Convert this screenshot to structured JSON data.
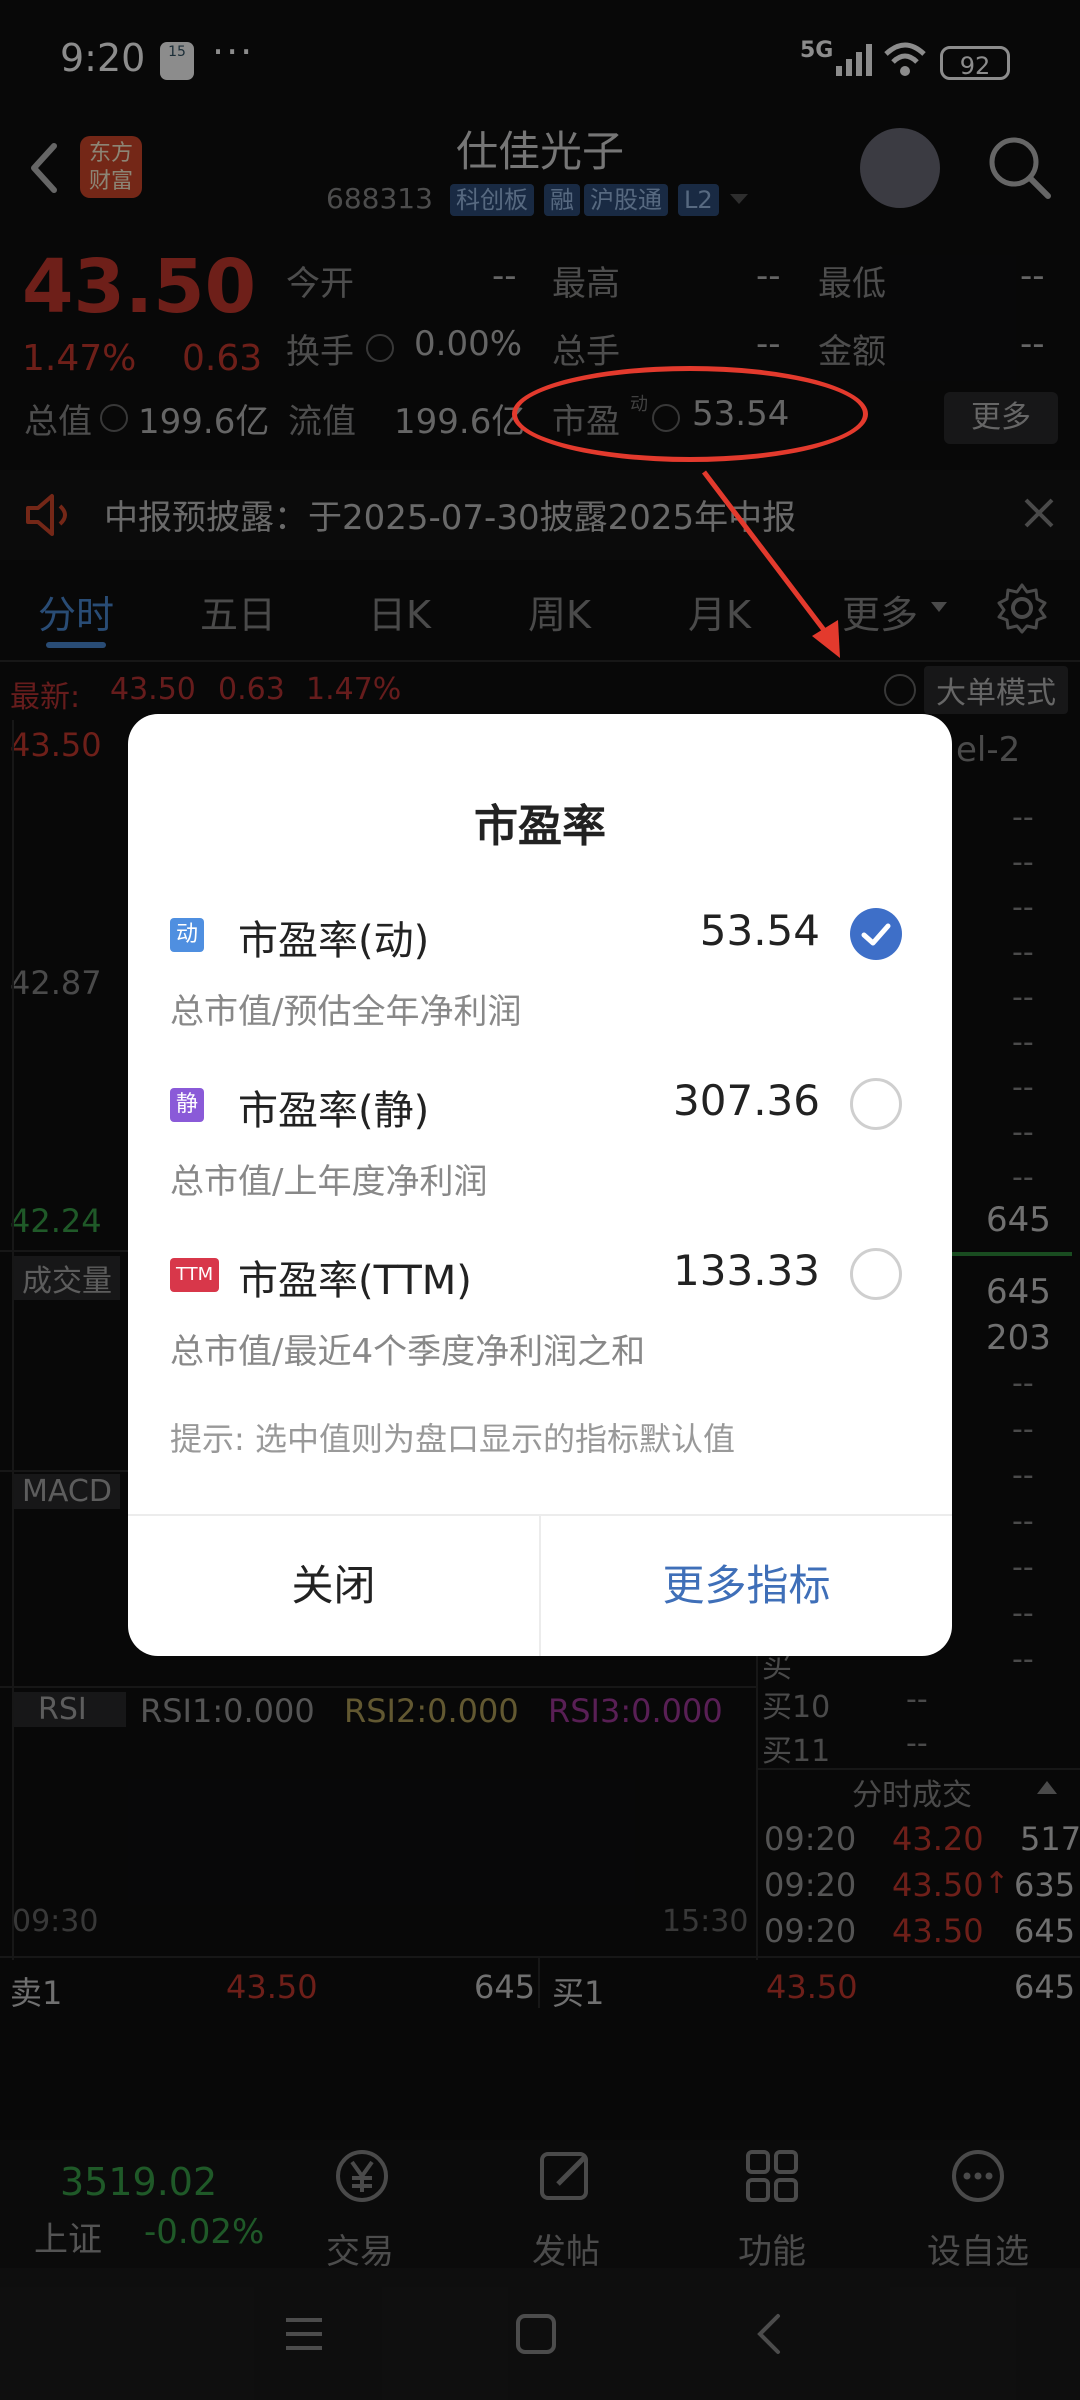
{
  "status_bar": {
    "time": "9:20",
    "calendar_day": "15",
    "more": "···",
    "network": "5G",
    "battery": "92"
  },
  "header": {
    "logo_text": "东方财富",
    "stock_name": "仕佳光子",
    "stock_code": "688313",
    "tags": [
      "科创板",
      "融",
      "沪股通",
      "L2"
    ]
  },
  "quote": {
    "price": "43.50",
    "change_pct": "1.47%",
    "change_abs": "0.63",
    "rows": [
      [
        {
          "label": "今开",
          "value": "--"
        },
        {
          "label": "最高",
          "value": "--"
        },
        {
          "label": "最低",
          "value": "--"
        }
      ],
      [
        {
          "label": "换手",
          "value": "0.00%"
        },
        {
          "label": "总手",
          "value": "--"
        },
        {
          "label": "金额",
          "value": "--"
        }
      ]
    ],
    "total_value_label": "总值",
    "total_value": "199.6亿",
    "float_value_label": "流值",
    "float_value": "199.6亿",
    "pe_label": "市盈",
    "pe_sup": "动",
    "pe_value": "53.54",
    "more_button": "更多"
  },
  "notice": {
    "text": "中报预披露：于2025-07-30披露2025年中报"
  },
  "tabs": [
    "分时",
    "五日",
    "日K",
    "周K",
    "月K",
    "更多"
  ],
  "chart": {
    "latest_label": "最新:",
    "latest_price": "43.50",
    "latest_change": "0.63",
    "latest_pct": "1.47%",
    "mode_button": "大单模式",
    "level_label": "el-2",
    "y_high": "43.50",
    "y_mid": "42.87",
    "y_low": "42.24",
    "volume_label": "成交量",
    "macd_label": "MACD",
    "rsi_label": "RSI",
    "rsi1": "RSI1:0.000",
    "rsi2": "RSI2:0.000",
    "rsi3": "RSI3:0.000",
    "time_start": "09:30",
    "time_end": "15:30"
  },
  "order_book": {
    "right_values": [
      "--",
      "--",
      "--",
      "--",
      "--",
      "--",
      "--",
      "--",
      "--",
      "645",
      "645",
      "203",
      "--",
      "--",
      "--",
      "--",
      "--",
      "--",
      "--"
    ],
    "buy10_label": "买10",
    "buy10_value": "--",
    "buy11_label": "买11",
    "buy11_value": "--",
    "buy_partial": "买"
  },
  "ticks": {
    "title": "分时成交",
    "rows": [
      {
        "time": "09:20",
        "price": "43.20",
        "vol": "517",
        "arrow": ""
      },
      {
        "time": "09:20",
        "price": "43.50",
        "vol": "635",
        "arrow": "↑"
      },
      {
        "time": "09:20",
        "price": "43.50",
        "vol": "645",
        "arrow": ""
      }
    ]
  },
  "bottom_quote": [
    {
      "label": "卖1",
      "price": "43.50",
      "vol": "645"
    },
    {
      "label": "买1",
      "price": "43.50",
      "vol": "645"
    }
  ],
  "bottom_nav": {
    "index_value": "3519.02",
    "index_name": "上证",
    "index_change": "-0.02%",
    "items": [
      "交易",
      "发帖",
      "功能",
      "设自选"
    ]
  },
  "dialog": {
    "title": "市盈率",
    "options": [
      {
        "badge": "动",
        "badge_color": "#4f8fe0",
        "name": "市盈率(动)",
        "value": "53.54",
        "desc": "总市值/预估全年净利润",
        "selected": true
      },
      {
        "badge": "静",
        "badge_color": "#8a5ad8",
        "name": "市盈率(静)",
        "value": "307.36",
        "desc": "总市值/上年度净利润",
        "selected": false
      },
      {
        "badge": "TTM",
        "badge_color": "#d8374a",
        "name": "市盈率(TTM)",
        "value": "133.33",
        "desc": "总市值/最近4个季度净利润之和",
        "selected": false
      }
    ],
    "hint": "提示: 选中值则为盘口显示的指标默认值",
    "close_button": "关闭",
    "more_button": "更多指标"
  }
}
